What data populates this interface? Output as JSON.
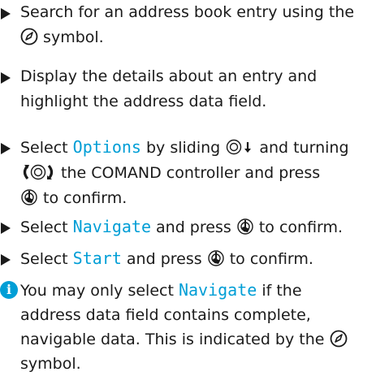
{
  "steps": [
    {
      "a": "Search for an address book entry using the",
      "b": "symbol."
    },
    {
      "a": "Display the details about an entry and",
      "b": "highlight the address data field."
    },
    {
      "a1": "Select ",
      "opt": "Options",
      "a2": " by sliding ",
      "a3": " and turning",
      "b2": " the COMAND controller and press",
      "c2": " to confirm."
    },
    {
      "s1": "Select ",
      "opt": "Navigate",
      "s2": " and press ",
      "s3": " to confirm."
    },
    {
      "s1": "Select ",
      "opt": "Start",
      "s2": " and press ",
      "s3": " to confirm."
    }
  ],
  "note": {
    "info_icon": "i",
    "a1": "You may only select ",
    "opt": "Navigate",
    "a2": " if the",
    "b": "address data field contains complete,",
    "c": "navigable data. This is indicated by the",
    "d": "symbol."
  },
  "icons": {
    "accent": "#009ed6",
    "nav_symbol": "compass-pen-icon",
    "controller": "controller-icon",
    "press": "press-icon"
  }
}
